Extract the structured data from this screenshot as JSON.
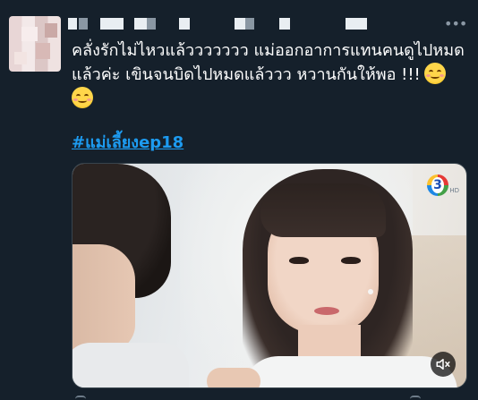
{
  "tweet": {
    "text_line1": "คลั่งรักไม่ไหวแล้ววววววว แม่ออกอาการแทนคนดูไปหมด",
    "text_line2": "แล้วค่ะ  เขินจนบิดไปหมดแล้ววว หวานกันให้พอ !!!",
    "hashtag": "#แม่เลี้ยงep18",
    "more_label": "•••",
    "emojis": [
      "smiling-face-with-smiling-eyes-blush",
      "smiling-face-with-smiling-eyes"
    ]
  },
  "media": {
    "channel_logo_text": "3",
    "channel_logo_sub": "HD",
    "mute_icon": "speaker-muted-icon"
  },
  "colors": {
    "background": "#15202b",
    "text": "#ffffff",
    "link": "#1d9bf0",
    "muted": "#8b98a5",
    "border": "#38444d"
  }
}
